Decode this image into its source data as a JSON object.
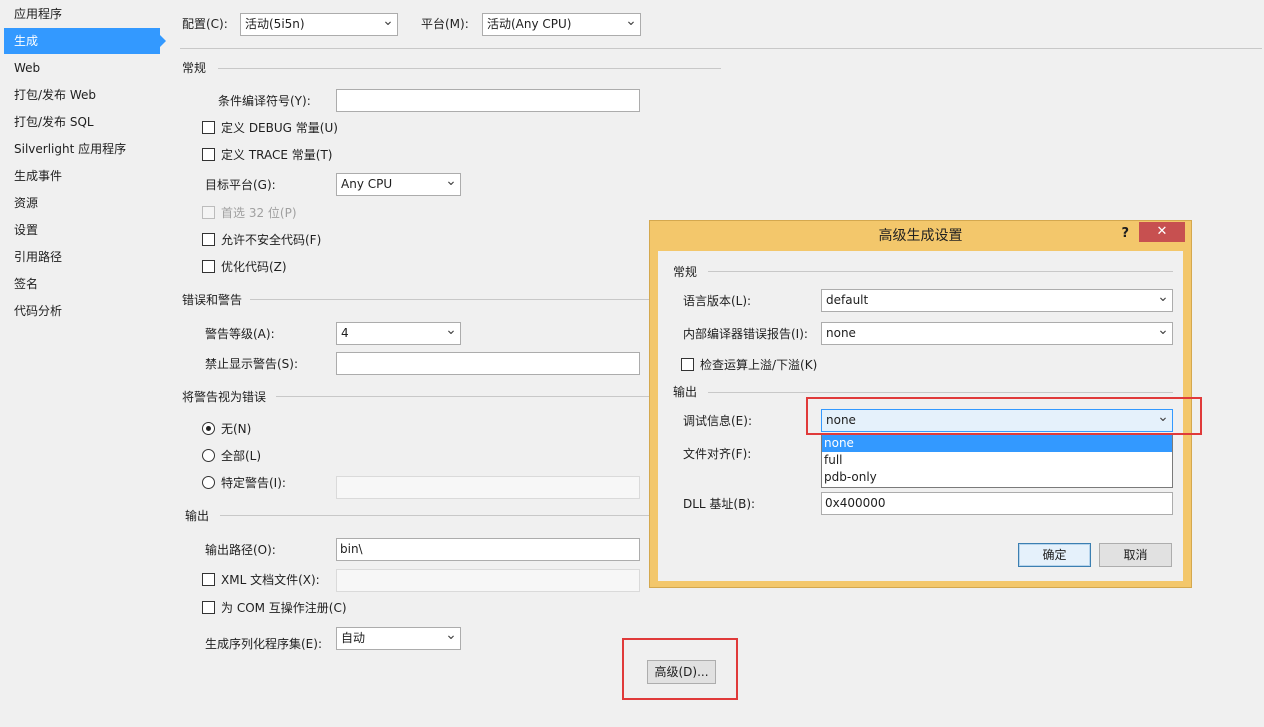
{
  "sidebar": {
    "items": [
      {
        "label": "应用程序"
      },
      {
        "label": "生成",
        "selected": true
      },
      {
        "label": "Web"
      },
      {
        "label": "打包/发布 Web"
      },
      {
        "label": "打包/发布 SQL"
      },
      {
        "label": "Silverlight 应用程序"
      },
      {
        "label": "生成事件"
      },
      {
        "label": "资源"
      },
      {
        "label": "设置"
      },
      {
        "label": "引用路径"
      },
      {
        "label": "签名"
      },
      {
        "label": "代码分析"
      }
    ]
  },
  "header": {
    "config_label": "配置(C):",
    "config_value": "活动(5i5n)",
    "platform_label": "平台(M):",
    "platform_value": "活动(Any CPU)"
  },
  "general": {
    "title": "常规",
    "cond_symbols_label": "条件编译符号(Y):",
    "cond_symbols_value": "",
    "define_debug": "定义 DEBUG 常量(U)",
    "define_trace": "定义 TRACE 常量(T)",
    "target_platform_label": "目标平台(G):",
    "target_platform_value": "Any CPU",
    "prefer32": "首选 32 位(P)",
    "allow_unsafe": "允许不安全代码(F)",
    "optimize": "优化代码(Z)"
  },
  "errors": {
    "title": "错误和警告",
    "warn_level_label": "警告等级(A):",
    "warn_level_value": "4",
    "suppress_label": "禁止显示警告(S):",
    "suppress_value": ""
  },
  "treat_warnings": {
    "title": "将警告视为错误",
    "none": "无(N)",
    "all": "全部(L)",
    "specific": "特定警告(I):"
  },
  "output": {
    "title": "输出",
    "path_label": "输出路径(O):",
    "path_value": "bin\\",
    "xml_doc": "XML 文档文件(X):",
    "com_register": "为 COM 互操作注册(C)",
    "serialization_label": "生成序列化程序集(E):",
    "serialization_value": "自动",
    "advanced_button": "高级(D)..."
  },
  "dialog": {
    "title": "高级生成设置",
    "help": "?",
    "close": "✕",
    "general_title": "常规",
    "lang_version_label": "语言版本(L):",
    "lang_version_value": "default",
    "internal_error_label": "内部编译器错误报告(I):",
    "internal_error_value": "none",
    "overflow_check": "检查运算上溢/下溢(K)",
    "output_title": "输出",
    "debug_info_label": "调试信息(E):",
    "debug_info_value": "none",
    "debug_options": [
      "none",
      "full",
      "pdb-only"
    ],
    "file_align_label": "文件对齐(F):",
    "dll_base_label": "DLL 基址(B):",
    "dll_base_value": "0x400000",
    "ok": "确定",
    "cancel": "取消"
  },
  "colors": {
    "selection": "#3399ff",
    "dialog_frame": "#f3c76b",
    "close_button": "#c75050",
    "highlight_box": "#e03a3a"
  }
}
